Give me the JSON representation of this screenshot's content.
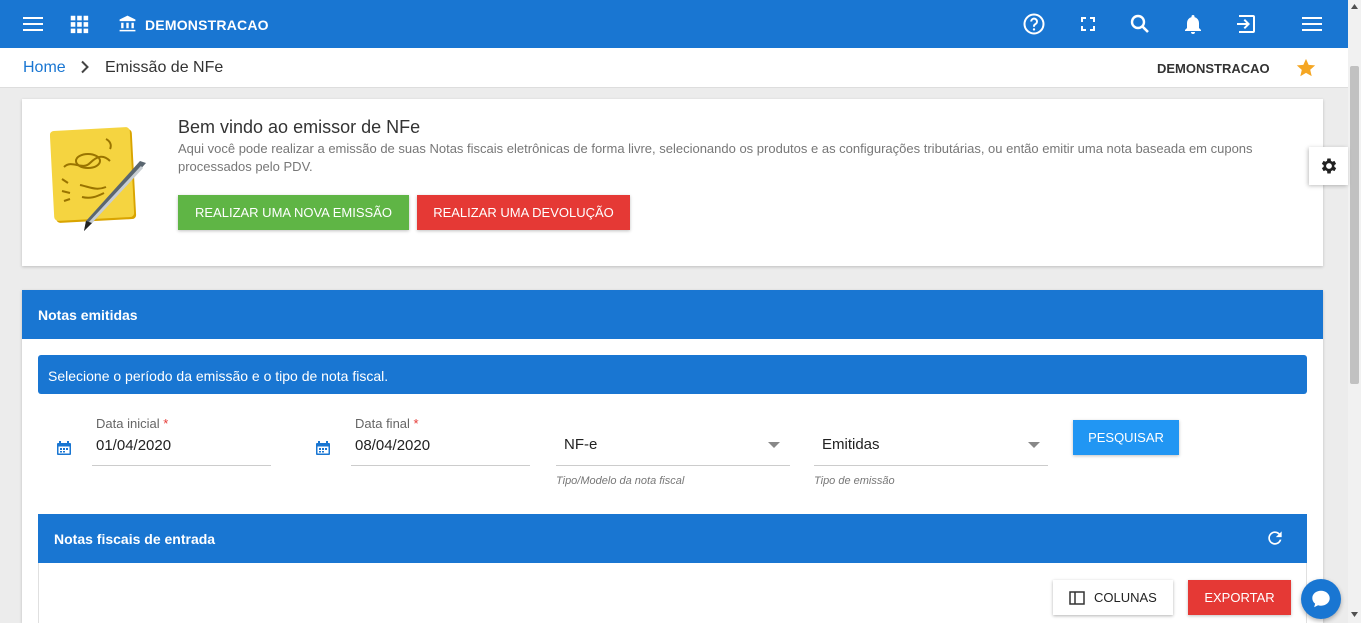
{
  "topbar": {
    "brand": "DEMONSTRACAO",
    "icons": [
      "menu-icon",
      "apps-icon",
      "bank-icon",
      "help-icon",
      "fullscreen-icon",
      "search-icon",
      "bell-icon",
      "logout-icon",
      "more-menu-icon"
    ],
    "color": "#1976d2"
  },
  "breadcrumb": {
    "home": "Home",
    "current": "Emissão de NFe",
    "company": "DEMONSTRACAO",
    "star_color": "#f5a623"
  },
  "welcome": {
    "title": "Bem vindo ao emissor de NFe",
    "description": "Aqui você pode realizar a emissão de suas Notas fiscais eletrônicas de forma livre, selecionando os produtos e as configurações tributárias, ou então emitir uma nota baseada em cupons processados pelo PDV.",
    "new_emission_label": "Realizar uma nova emissão",
    "return_label": "Realizar uma devolução",
    "green": "#5fb545",
    "red": "#e53935"
  },
  "notas_emitidas": {
    "title": "Notas emitidas",
    "info": "Selecione o período da emissão e o tipo de nota fiscal.",
    "start_date": {
      "label": "Data inicial",
      "required": "*",
      "value": "01/04/2020"
    },
    "end_date": {
      "label": "Data final",
      "required": "*",
      "value": "08/04/2020"
    },
    "model": {
      "value": "NF-e",
      "hint": "Tipo/Modelo da nota fiscal"
    },
    "emission_type": {
      "value": "Emitidas",
      "hint": "Tipo de emissão"
    },
    "search_label": "PESQUISAR"
  },
  "entrada": {
    "title": "Notas fiscais de entrada",
    "columns_label": "COLUNAS",
    "export_label": "EXPORTAR"
  }
}
